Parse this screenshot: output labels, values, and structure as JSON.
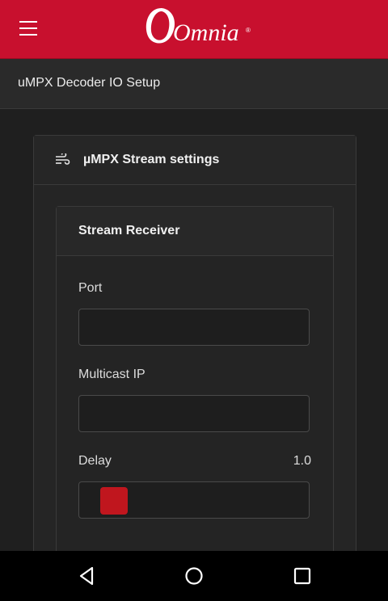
{
  "header": {
    "menu_icon": "hamburger-menu-icon",
    "logo_text": "Omnia",
    "logo_mark": "®",
    "brand_color": "#c8102e"
  },
  "page": {
    "title": "uMPX Decoder IO Setup"
  },
  "stream_card": {
    "icon": "stream-wind-icon",
    "title": "µMPX Stream settings",
    "receiver": {
      "title": "Stream Receiver",
      "port": {
        "label": "Port",
        "value": ""
      },
      "multicast": {
        "label": "Multicast IP",
        "value": ""
      },
      "delay": {
        "label": "Delay",
        "value": "1.0",
        "slider_position": 0.04,
        "thumb_color": "#c0161e"
      }
    }
  },
  "navbar": {
    "back_icon": "back-triangle-icon",
    "home_icon": "home-circle-icon",
    "recents_icon": "recents-square-icon"
  }
}
